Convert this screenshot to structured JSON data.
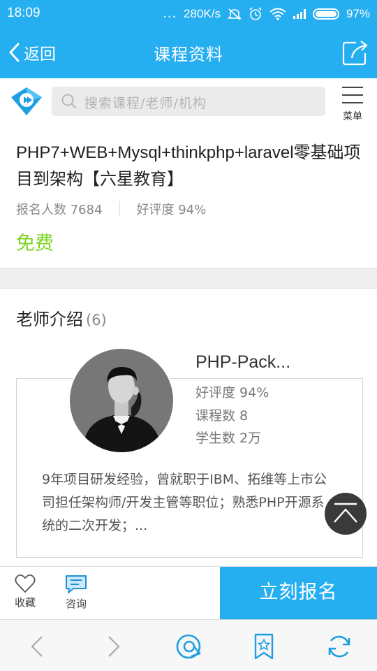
{
  "status_bar": {
    "time": "18:09",
    "dots": "...",
    "speed": "280K/s",
    "battery": "97%"
  },
  "nav": {
    "back_label": "返回",
    "title": "课程资料",
    "share_icon": "share-icon"
  },
  "search": {
    "placeholder": "搜索课程/老师/机构",
    "menu_label": "菜单"
  },
  "course": {
    "title": "PHP7+WEB+Mysql+thinkphp+laravel零基础项目到架构【六星教育】",
    "enrolled_label": "报名人数 7684",
    "rating_label": "好评度 94%",
    "price": "免费"
  },
  "teachers": {
    "heading": "老师介绍",
    "count": "(6)",
    "items": [
      {
        "name": "PHP-Pack...",
        "rating": "好评度 94%",
        "courses": "课程数 8",
        "students": "学生数 2万",
        "description": "9年项目研发经验，曾就职于IBM、拓维等上市公司担任架构师/开发主管等职位；熟悉PHP开源系统的二次开发；..."
      }
    ]
  },
  "actions": {
    "favorite_label": "收藏",
    "consult_label": "咨询",
    "enroll_label": "立刻报名"
  },
  "colors": {
    "primary": "#25aef0",
    "price_green": "#7ed321",
    "dark_button": "#3a3a3a"
  }
}
